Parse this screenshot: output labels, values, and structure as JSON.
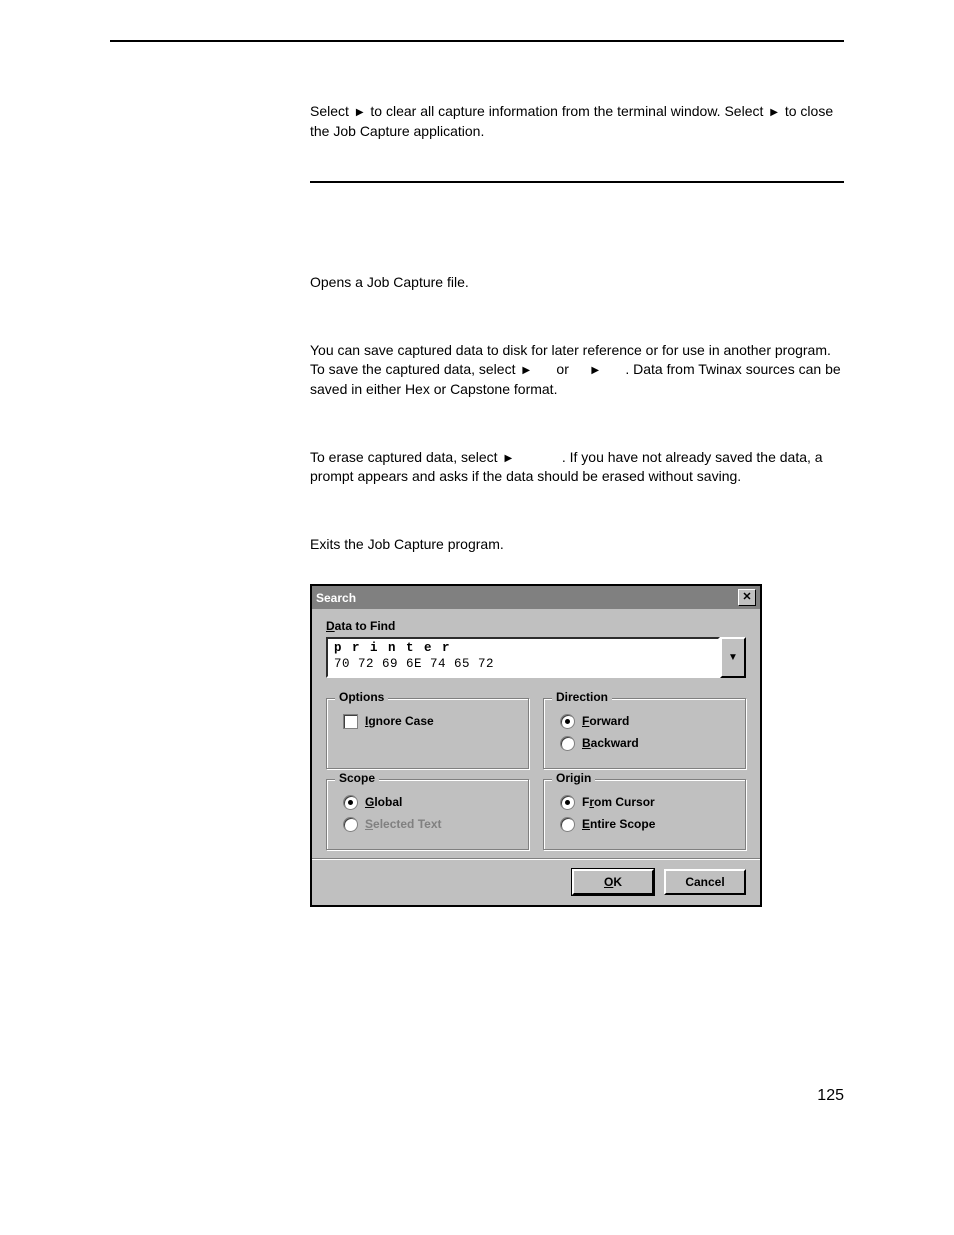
{
  "intro": {
    "p1a": "Select ",
    "p1b": " to clear all capture information from the terminal window. Select ",
    "p1c": " to close the Job Capture application."
  },
  "open": {
    "text": "Opens a Job Capture file."
  },
  "save": {
    "p_a": "You can save captured data to disk for later reference or for use in another program. To save the captured data, select ",
    "p_or": " or ",
    "p_end": ". Data from Twinax sources can be saved in either Hex or Capstone format."
  },
  "reset": {
    "p_a": "To erase captured data, select ",
    "p_b": ". If you have not already saved the data, a prompt appears and asks if the data should be erased without saving."
  },
  "exit": {
    "text": "Exits the Job Capture program."
  },
  "dialog": {
    "title": "Search",
    "data_label_pre": "D",
    "data_label_post": "ata to Find",
    "input_letters": [
      "p",
      "r",
      "i",
      "n",
      "t",
      "e",
      "r"
    ],
    "input_hex": "70 72 69 6E 74 65 72",
    "options_title": "Options",
    "ignore_pre": "I",
    "ignore_post": "gnore Case",
    "direction_title": "Direction",
    "forward_pre": "F",
    "forward_post": "orward",
    "backward_pre": "B",
    "backward_post": "ackward",
    "scope_title": "Scope",
    "global_pre": "G",
    "global_post": "lobal",
    "selected_pre": "S",
    "selected_post": "elected Text",
    "origin_title": "Origin",
    "fromcursor_pre": "r",
    "fromcursor_a": "F",
    "fromcursor_b": "om Cursor",
    "entire_pre": "E",
    "entire_post": "ntire Scope",
    "ok_pre": "O",
    "ok_post": "K",
    "cancel": "Cancel"
  },
  "page_number": "125"
}
